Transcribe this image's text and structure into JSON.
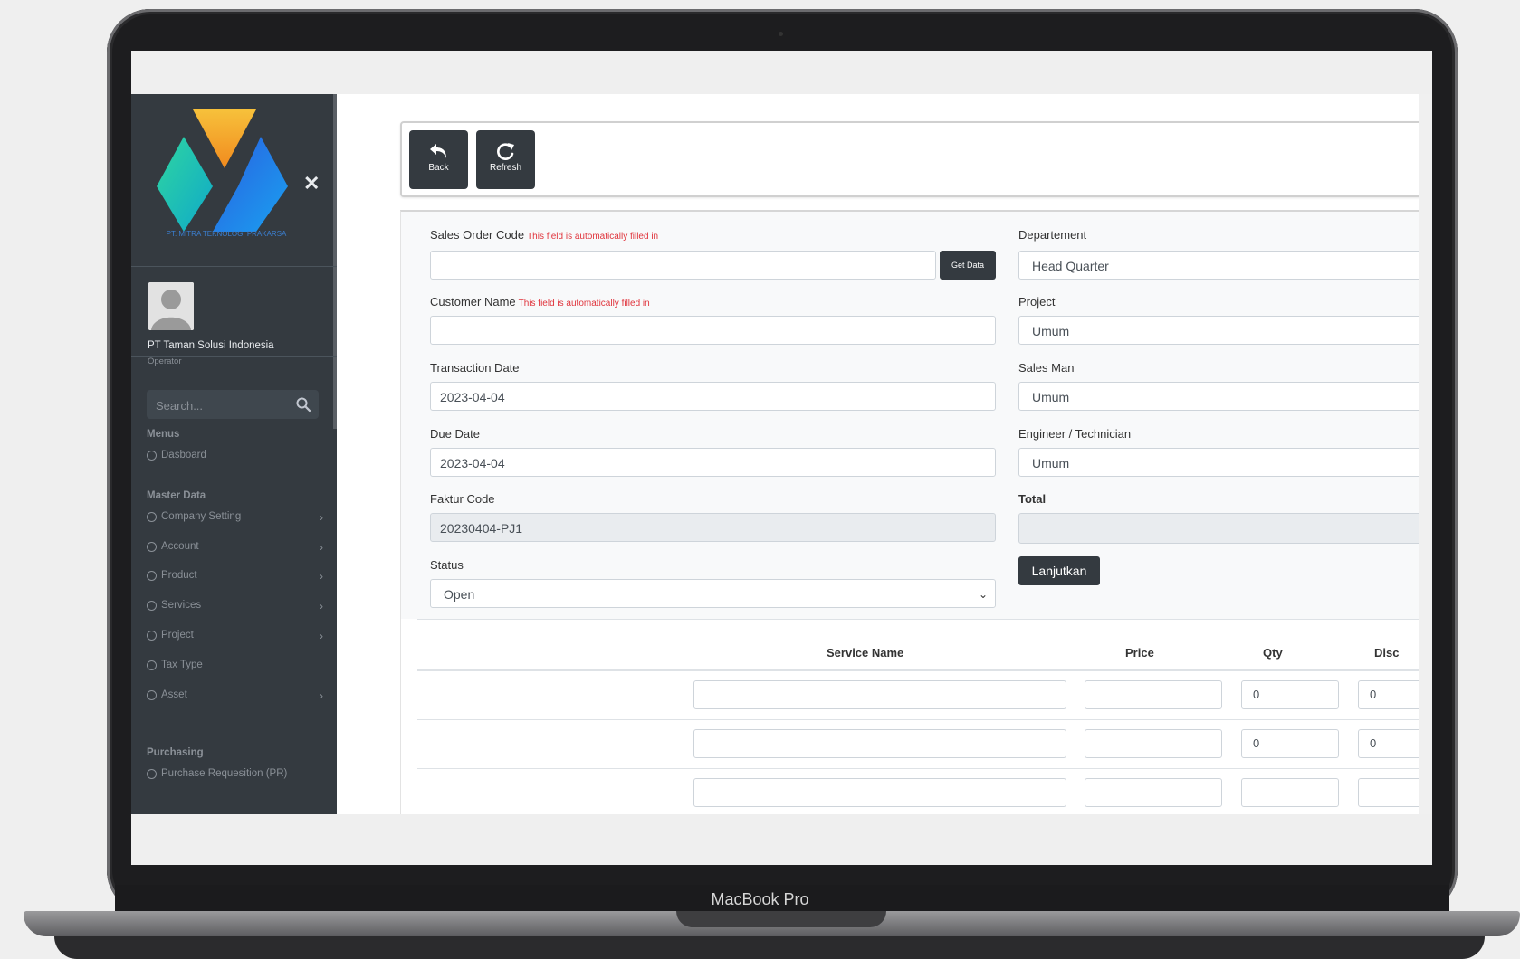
{
  "device": {
    "brand_label": "MacBook Pro"
  },
  "company": {
    "logo_caption": "PT. MITRA TEKNOLOGI PRAKARSA"
  },
  "user": {
    "name": "PT Taman Solusi Indonesia",
    "role": "Operator"
  },
  "search": {
    "placeholder": "Search..."
  },
  "sidebar": {
    "sections": [
      {
        "header": "Menus",
        "items": [
          {
            "label": "Dasboard",
            "has_children": false
          }
        ]
      },
      {
        "header": "Master Data",
        "items": [
          {
            "label": "Company Setting",
            "has_children": true
          },
          {
            "label": "Account",
            "has_children": true
          },
          {
            "label": "Product",
            "has_children": true
          },
          {
            "label": "Services",
            "has_children": true
          },
          {
            "label": "Project",
            "has_children": true
          },
          {
            "label": "Tax Type",
            "has_children": false
          },
          {
            "label": "Asset",
            "has_children": true
          }
        ]
      },
      {
        "header": "Purchasing",
        "items": [
          {
            "label": "Purchase Requesition (PR)",
            "has_children": false
          }
        ]
      }
    ]
  },
  "toolbar": {
    "back_label": "Back",
    "refresh_label": "Refresh"
  },
  "form": {
    "auto_note": "This field is automatically filled in",
    "sales_order_code": {
      "label": "Sales Order Code",
      "value": ""
    },
    "get_data_label": "Get Data",
    "customer_name": {
      "label": "Customer Name",
      "value": ""
    },
    "transaction_date": {
      "label": "Transaction Date",
      "value": "2023-04-04"
    },
    "due_date": {
      "label": "Due Date",
      "value": "2023-04-04"
    },
    "faktur_code": {
      "label": "Faktur Code",
      "value": "20230404-PJ1"
    },
    "status": {
      "label": "Status",
      "value": "Open"
    },
    "departement": {
      "label": "Departement",
      "value": "Head Quarter"
    },
    "project": {
      "label": "Project",
      "value": "Umum"
    },
    "sales_man": {
      "label": "Sales Man",
      "value": "Umum"
    },
    "engineer": {
      "label": "Engineer / Technician",
      "value": "Umum"
    },
    "total": {
      "label": "Total",
      "value": ""
    },
    "continue_label": "Lanjutkan"
  },
  "table": {
    "headers": [
      "Service Name",
      "Price",
      "Qty",
      "Disc"
    ],
    "rows": [
      {
        "service_name": "",
        "price": "",
        "qty": "0",
        "disc": "0"
      },
      {
        "service_name": "",
        "price": "",
        "qty": "0",
        "disc": "0"
      }
    ]
  },
  "colors": {
    "sidebar_bg": "#343a40",
    "note_red": "#e0343c",
    "button_dark": "#343a40"
  }
}
